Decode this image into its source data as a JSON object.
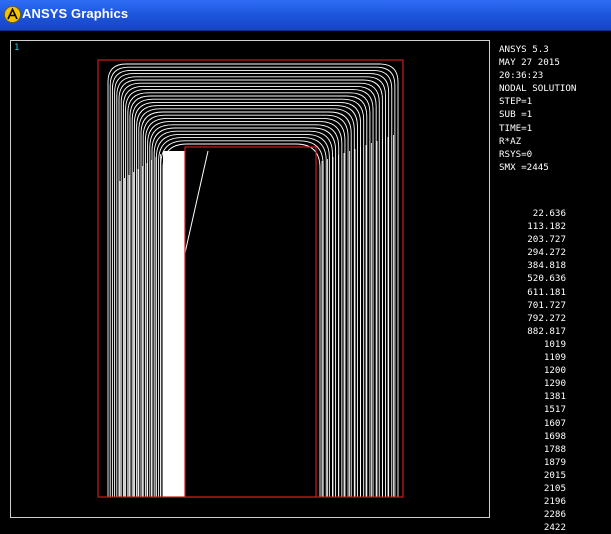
{
  "window": {
    "title": "ANSYS Graphics",
    "titlebar_color": "#1b53d9",
    "icon": "ansys-logo-icon"
  },
  "viewport": {
    "window_number": "1",
    "window_number_color": "#27c9e8",
    "outline_color": "#cc1a1a",
    "contour_color": "#ffffff"
  },
  "info": {
    "version": "ANSYS 5.3",
    "date": "MAY 27 2015",
    "time": "20:36:23",
    "solution": "NODAL SOLUTION",
    "step": "STEP=1",
    "sub": "SUB =1",
    "time_val": "TIME=1",
    "result": "R*AZ",
    "rsys": "RSYS=0",
    "smx": "SMX =2445"
  },
  "legend": {
    "values": [
      "22.636",
      "113.182",
      "203.727",
      "294.272",
      "384.818",
      "520.636",
      "611.181",
      "701.727",
      "792.272",
      "882.817",
      "1019",
      "1109",
      "1200",
      "1290",
      "1381",
      "1517",
      "1607",
      "1698",
      "1788",
      "1879",
      "2015",
      "2105",
      "2196",
      "2286",
      "2422"
    ]
  }
}
